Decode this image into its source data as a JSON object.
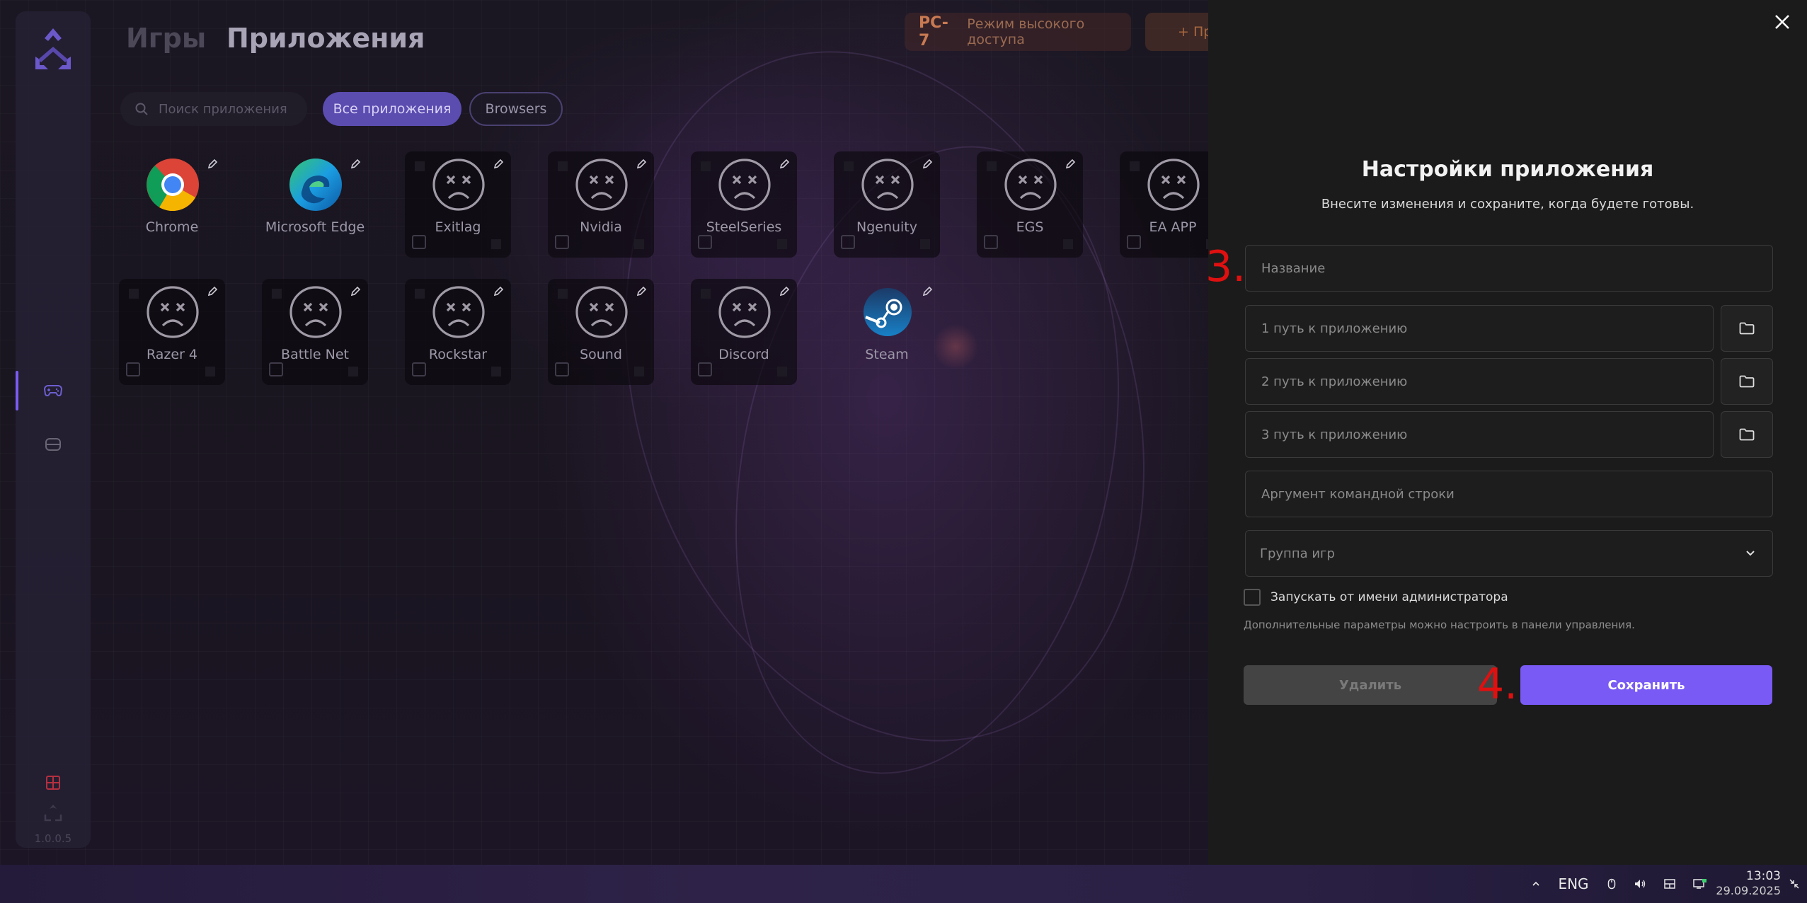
{
  "header": {
    "tab_games": "Игры",
    "tab_apps": "Приложения",
    "pc_name": "PC-7",
    "pc_mode": "Режим высокого доступа",
    "add_button": "+ Пр"
  },
  "sidebar": {
    "version": "1.0.0.5",
    "items": [
      {
        "name": "games",
        "icon": "gamepad-icon"
      },
      {
        "name": "apps",
        "icon": "box-icon"
      }
    ]
  },
  "search": {
    "placeholder": "Поиск приложения"
  },
  "filters": {
    "all": "Все приложения",
    "browsers": "Browsers"
  },
  "apps": [
    {
      "label": "Chrome",
      "icon": "chrome-icon"
    },
    {
      "label": "Microsoft Edge",
      "icon": "edge-icon"
    },
    {
      "label": "Exitlag",
      "icon": "sad-face-icon"
    },
    {
      "label": "Nvidia",
      "icon": "sad-face-icon"
    },
    {
      "label": "SteelSeries",
      "icon": "sad-face-icon"
    },
    {
      "label": "Ngenuity",
      "icon": "sad-face-icon"
    },
    {
      "label": "EGS",
      "icon": "sad-face-icon"
    },
    {
      "label": "EA APP",
      "icon": "sad-face-icon"
    },
    {
      "label": "Razer 4",
      "icon": "sad-face-icon"
    },
    {
      "label": "Battle Net",
      "icon": "sad-face-icon"
    },
    {
      "label": "Rockstar",
      "icon": "sad-face-icon"
    },
    {
      "label": "Sound",
      "icon": "sad-face-icon"
    },
    {
      "label": "Discord",
      "icon": "sad-face-icon"
    },
    {
      "label": "Steam",
      "icon": "steam-icon"
    }
  ],
  "panel": {
    "title": "Настройки приложения",
    "subtitle": "Внесите изменения и сохраните, когда будете готовы.",
    "name_placeholder": "Название",
    "path1_placeholder": "1 путь к приложению",
    "path2_placeholder": "2 путь к приложению",
    "path3_placeholder": "3 путь к приложению",
    "args_placeholder": "Аргумент командной строки",
    "group_select": "Группа игр",
    "run_as_admin": "Запускать от имени администратора",
    "hint": "Дополнительные параметры можно настроить в панели управления.",
    "delete_button": "Удалить",
    "save_button": "Сохранить",
    "step_3": "3.",
    "step_4": "4."
  },
  "colors": {
    "accent": "#7a5af5",
    "chip_active": "#5b4cb0",
    "panel_bg": "#1b1b1b",
    "annotation": "#e01010"
  },
  "taskbar": {
    "lang": "ENG",
    "time": "13:03",
    "date": "29.09.2025"
  }
}
